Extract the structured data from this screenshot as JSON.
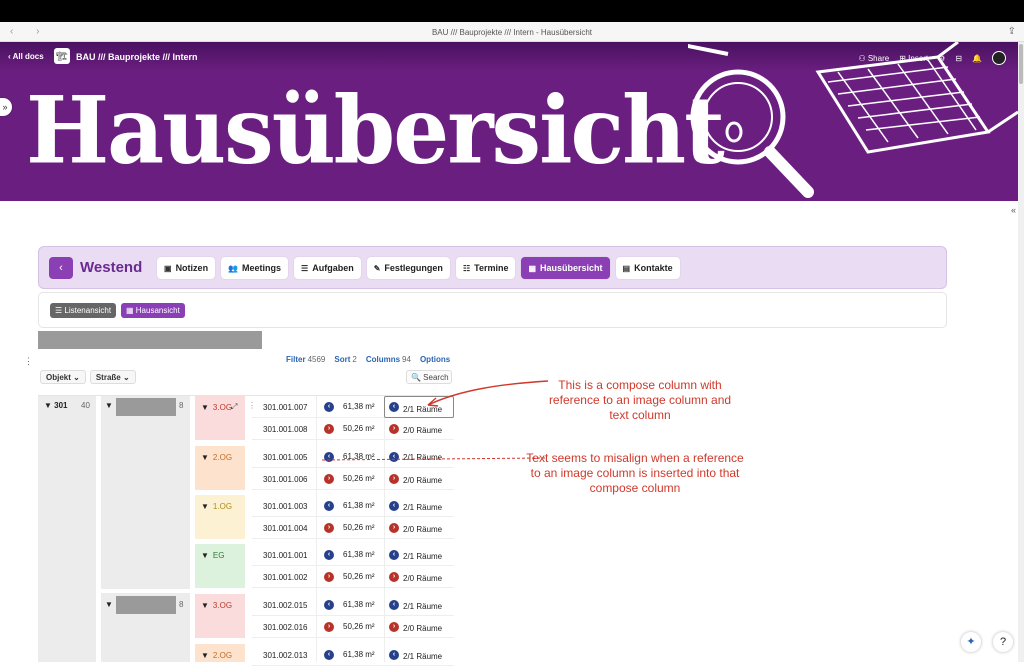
{
  "window": {
    "title": "BAU /// Bauprojekte /// Intern - Hausübersicht"
  },
  "doc": {
    "all_docs": "‹ All docs",
    "title": "BAU /// Bauprojekte /// Intern",
    "share": "Share",
    "insert": "Insert"
  },
  "banner": {
    "heading": "Hausübersicht"
  },
  "section": {
    "name": "Westend",
    "tabs": [
      {
        "icon": "▣",
        "label": "Notizen"
      },
      {
        "icon": "👥",
        "label": "Meetings"
      },
      {
        "icon": "☰",
        "label": "Aufgaben"
      },
      {
        "icon": "✎",
        "label": "Festlegungen"
      },
      {
        "icon": "☷",
        "label": "Termine"
      },
      {
        "icon": "▦",
        "label": "Hausübersicht"
      },
      {
        "icon": "▤",
        "label": "Kontakte"
      }
    ]
  },
  "views": {
    "list": "☰ Listenansicht",
    "house": "▦ Hausansicht"
  },
  "toolbar": {
    "filter_label": "Filter",
    "filter_count": "4569",
    "sort_label": "Sort",
    "sort_count": "2",
    "columns_label": "Columns",
    "columns_count": "94",
    "options_label": "Options"
  },
  "filters": {
    "objekt": "Objekt ⌄",
    "strasse": "Straße ⌄",
    "search": "🔍 Search"
  },
  "table": {
    "objekt": {
      "label": "▼ 301",
      "count": "40"
    },
    "street_groups": [
      {
        "caret": "▼",
        "count": "8"
      },
      {
        "caret": "▼",
        "count": "8"
      }
    ],
    "floors": [
      "3.OG",
      "2.OG",
      "1.OG",
      "EG",
      "3.OG",
      "2.OG"
    ],
    "rows": [
      {
        "unit": "301.001.007",
        "area": "61,38 m²",
        "rooms": "2/1 Räume",
        "dir": "left"
      },
      {
        "unit": "301.001.008",
        "area": "50,26 m²",
        "rooms": "2/0 Räume",
        "dir": "right"
      },
      {
        "unit": "301.001.005",
        "area": "61,38 m²",
        "rooms": "2/1 Räume",
        "dir": "left"
      },
      {
        "unit": "301.001.006",
        "area": "50,26 m²",
        "rooms": "2/0 Räume",
        "dir": "right"
      },
      {
        "unit": "301.001.003",
        "area": "61,38 m²",
        "rooms": "2/1 Räume",
        "dir": "left"
      },
      {
        "unit": "301.001.004",
        "area": "50,26 m²",
        "rooms": "2/0 Räume",
        "dir": "right"
      },
      {
        "unit": "301.001.001",
        "area": "61,38 m²",
        "rooms": "2/1 Räume",
        "dir": "left"
      },
      {
        "unit": "301.001.002",
        "area": "50,26 m²",
        "rooms": "2/0 Räume",
        "dir": "right"
      },
      {
        "unit": "301.002.015",
        "area": "61,38 m²",
        "rooms": "2/1 Räume",
        "dir": "left"
      },
      {
        "unit": "301.002.016",
        "area": "50,26 m²",
        "rooms": "2/0 Räume",
        "dir": "right"
      },
      {
        "unit": "301.002.013",
        "area": "61,38 m²",
        "rooms": "2/1 Räume",
        "dir": "left"
      }
    ]
  },
  "annotations": {
    "compose_column": "This is a compose column with reference to an image column and text column",
    "misalign": "Text seems to misalign when a reference to an image column is inserted into that compose column"
  },
  "colors": {
    "banner": "#6a1f80",
    "accent": "#8a3fb5",
    "annotation": "#d0392b"
  }
}
